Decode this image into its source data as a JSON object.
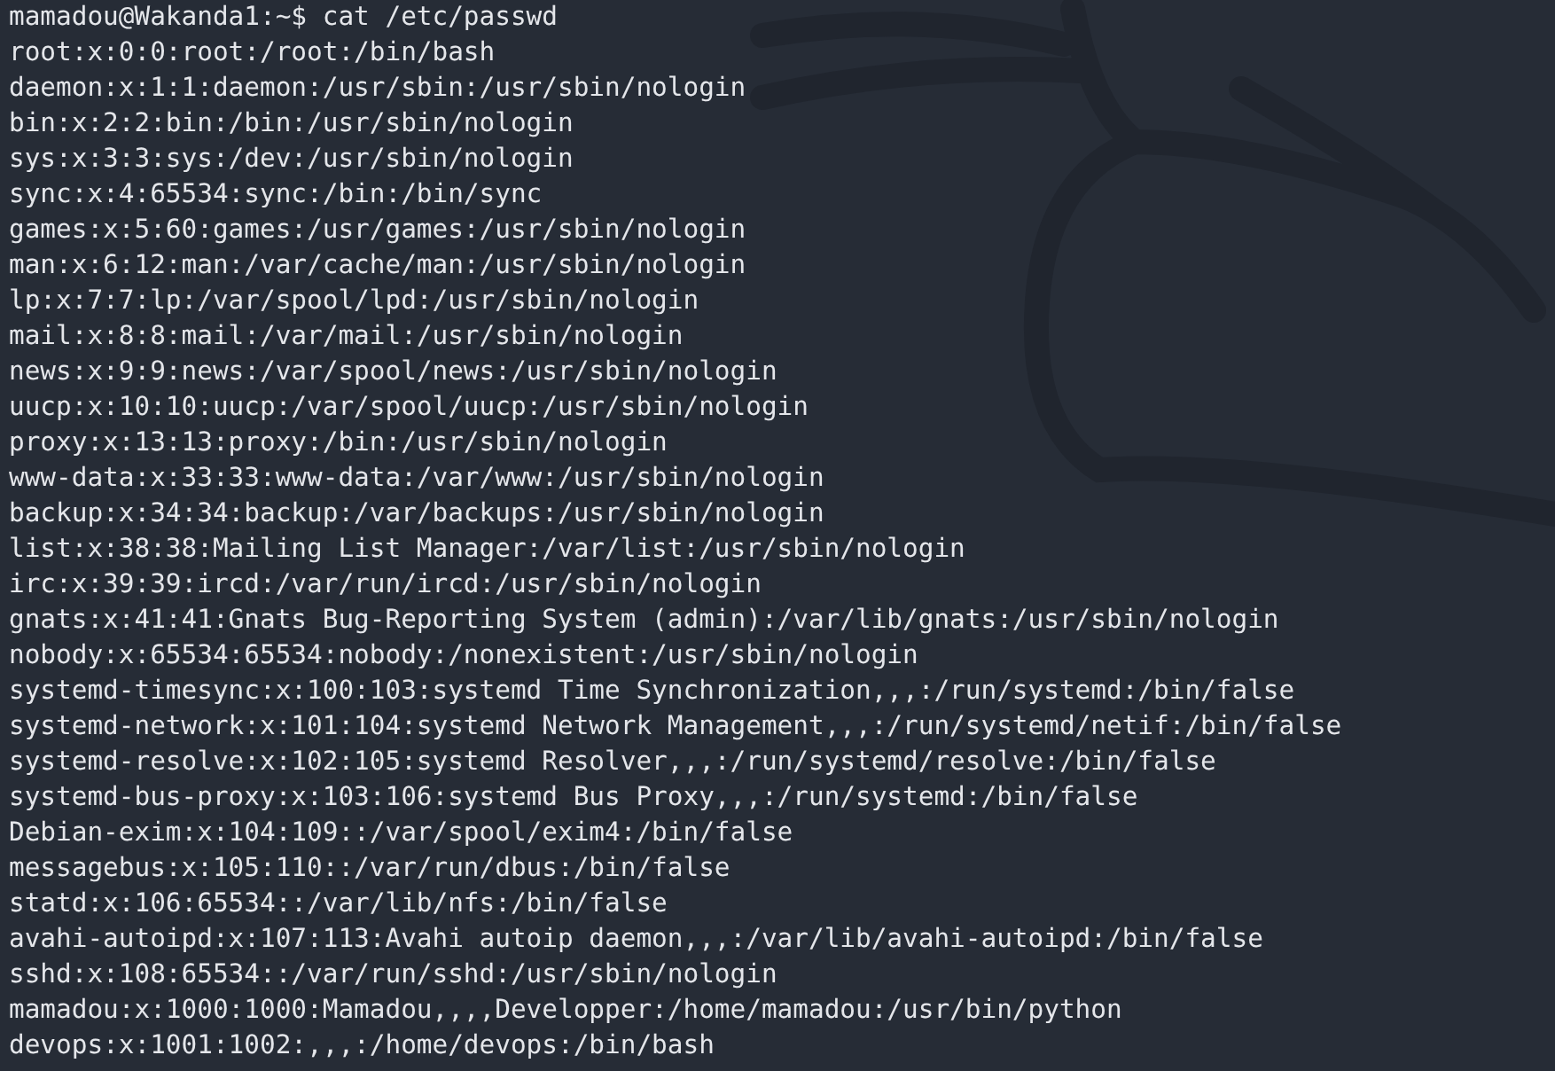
{
  "terminal": {
    "lines": [
      "mamadou@Wakanda1:~$ cat /etc/passwd",
      "root:x:0:0:root:/root:/bin/bash",
      "daemon:x:1:1:daemon:/usr/sbin:/usr/sbin/nologin",
      "bin:x:2:2:bin:/bin:/usr/sbin/nologin",
      "sys:x:3:3:sys:/dev:/usr/sbin/nologin",
      "sync:x:4:65534:sync:/bin:/bin/sync",
      "games:x:5:60:games:/usr/games:/usr/sbin/nologin",
      "man:x:6:12:man:/var/cache/man:/usr/sbin/nologin",
      "lp:x:7:7:lp:/var/spool/lpd:/usr/sbin/nologin",
      "mail:x:8:8:mail:/var/mail:/usr/sbin/nologin",
      "news:x:9:9:news:/var/spool/news:/usr/sbin/nologin",
      "uucp:x:10:10:uucp:/var/spool/uucp:/usr/sbin/nologin",
      "proxy:x:13:13:proxy:/bin:/usr/sbin/nologin",
      "www-data:x:33:33:www-data:/var/www:/usr/sbin/nologin",
      "backup:x:34:34:backup:/var/backups:/usr/sbin/nologin",
      "list:x:38:38:Mailing List Manager:/var/list:/usr/sbin/nologin",
      "irc:x:39:39:ircd:/var/run/ircd:/usr/sbin/nologin",
      "gnats:x:41:41:Gnats Bug-Reporting System (admin):/var/lib/gnats:/usr/sbin/nologin",
      "nobody:x:65534:65534:nobody:/nonexistent:/usr/sbin/nologin",
      "systemd-timesync:x:100:103:systemd Time Synchronization,,,:/run/systemd:/bin/false",
      "systemd-network:x:101:104:systemd Network Management,,,:/run/systemd/netif:/bin/false",
      "systemd-resolve:x:102:105:systemd Resolver,,,:/run/systemd/resolve:/bin/false",
      "systemd-bus-proxy:x:103:106:systemd Bus Proxy,,,:/run/systemd:/bin/false",
      "Debian-exim:x:104:109::/var/spool/exim4:/bin/false",
      "messagebus:x:105:110::/var/run/dbus:/bin/false",
      "statd:x:106:65534::/var/lib/nfs:/bin/false",
      "avahi-autoipd:x:107:113:Avahi autoip daemon,,,:/var/lib/avahi-autoipd:/bin/false",
      "sshd:x:108:65534::/var/run/sshd:/usr/sbin/nologin",
      "mamadou:x:1000:1000:Mamadou,,,,Developper:/home/mamadou:/usr/bin/python",
      "devops:x:1001:1002:,,,:/home/devops:/bin/bash"
    ]
  }
}
